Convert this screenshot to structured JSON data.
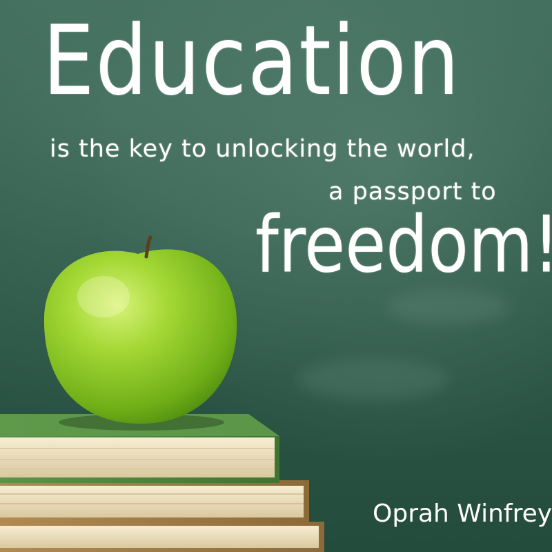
{
  "quote": {
    "headline": "Education",
    "line2": "is the key to unlocking the world,",
    "line3": "a passport to",
    "line4": "freedom!"
  },
  "attribution": "Oprah Winfrey",
  "colors": {
    "chalkboard": "#2f5a49",
    "chalk_text": "#ffffff",
    "apple": "#8fcf2a",
    "book_cover": "#4e8a3e",
    "book_pages": "#efe3c4"
  },
  "objects": [
    "apple-icon",
    "book-stack-icon"
  ]
}
